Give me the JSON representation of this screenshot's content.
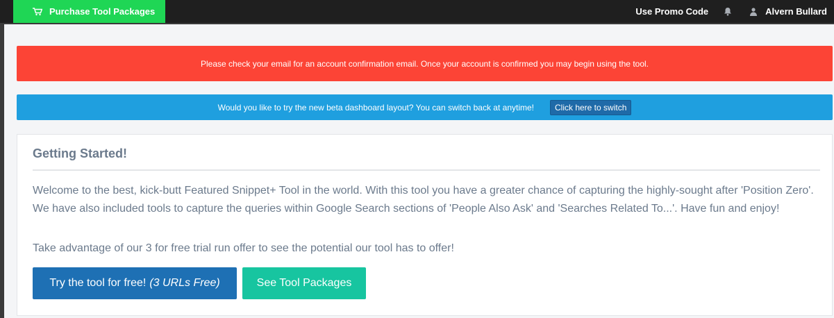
{
  "topbar": {
    "purchase_label": "Purchase Tool Packages",
    "promo_label": "Use Promo Code",
    "user_name": "Alvern Bullard"
  },
  "alerts": {
    "confirm_email": "Please check your email for an account confirmation email. Once your account is confirmed you may begin using the tool.",
    "beta_prompt": "Would you like to try the new beta dashboard layout? You can switch back at anytime!",
    "beta_switch_label": "Click here to switch"
  },
  "card": {
    "title": "Getting Started!",
    "body": "Welcome to the best, kick-butt Featured Snippet+ Tool in the world. With this tool you have a greater chance of capturing the highly-sought after 'Position Zero'. We have also included tools to capture the queries within Google Search sections of 'People Also Ask' and 'Searches Related To...'. Have fun and enjoy!",
    "offer": "Take advantage of our 3 for free trial run offer to see the potential our tool has to offer!",
    "free_button_label": "Try the tool for free!",
    "free_button_note": "(3 URLs Free)",
    "packages_button_label": "See Tool Packages"
  },
  "colors": {
    "purchase_green": "#1fd655",
    "alert_red": "#fc4436",
    "info_blue": "#1f9fdf",
    "primary_blue": "#1e70b4",
    "teal": "#17c5a0"
  }
}
